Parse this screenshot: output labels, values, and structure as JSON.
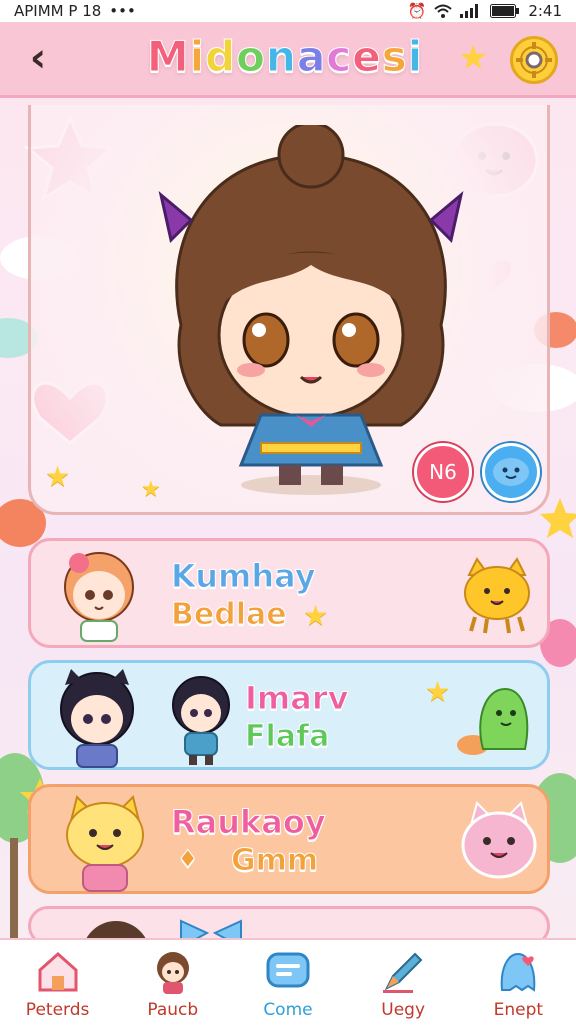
{
  "status_bar": {
    "left_text": "APIMM P 18",
    "dots": "•••",
    "time": "2:41"
  },
  "header": {
    "back_glyph": "‹",
    "title": "Midonacesi",
    "title_colors": [
      "#f2607c",
      "#f7a63a",
      "#f2d33a",
      "#6fcf5c",
      "#44b6e8",
      "#7b7fe8",
      "#e27ad8",
      "#f2607c",
      "#f7a63a",
      "#44b6e8"
    ],
    "star_glyph": "★",
    "settings_icon": "gear-icon"
  },
  "profile": {
    "level_badge": "N6",
    "chat_icon": "blue-blob-icon"
  },
  "cards": [
    {
      "title": "Kumhay",
      "subtitle": "Bedlae",
      "title_color": "#5aa7e6",
      "subtitle_color": "#f2a23a",
      "star": "★",
      "theme": "pink"
    },
    {
      "title": "Imarv",
      "subtitle": "Flafa",
      "title_color": "#ef5fa0",
      "subtitle_color": "#5ec95a",
      "star": "★",
      "theme": "blue"
    },
    {
      "title": "Raukaoy",
      "subtitle": "Gmm",
      "title_color": "#ef5fa0",
      "subtitle_color": "#f2a23a",
      "subtitle_prefix": "♦",
      "theme": "orange"
    }
  ],
  "nav": [
    {
      "label": "Peterds",
      "icon": "home-icon",
      "active": false
    },
    {
      "label": "Paucb",
      "icon": "character-icon",
      "active": false
    },
    {
      "label": "Come",
      "icon": "chat-icon",
      "active": true
    },
    {
      "label": "Uegy",
      "icon": "pencil-icon",
      "active": false
    },
    {
      "label": "Enept",
      "icon": "ghost-icon",
      "active": false
    }
  ]
}
